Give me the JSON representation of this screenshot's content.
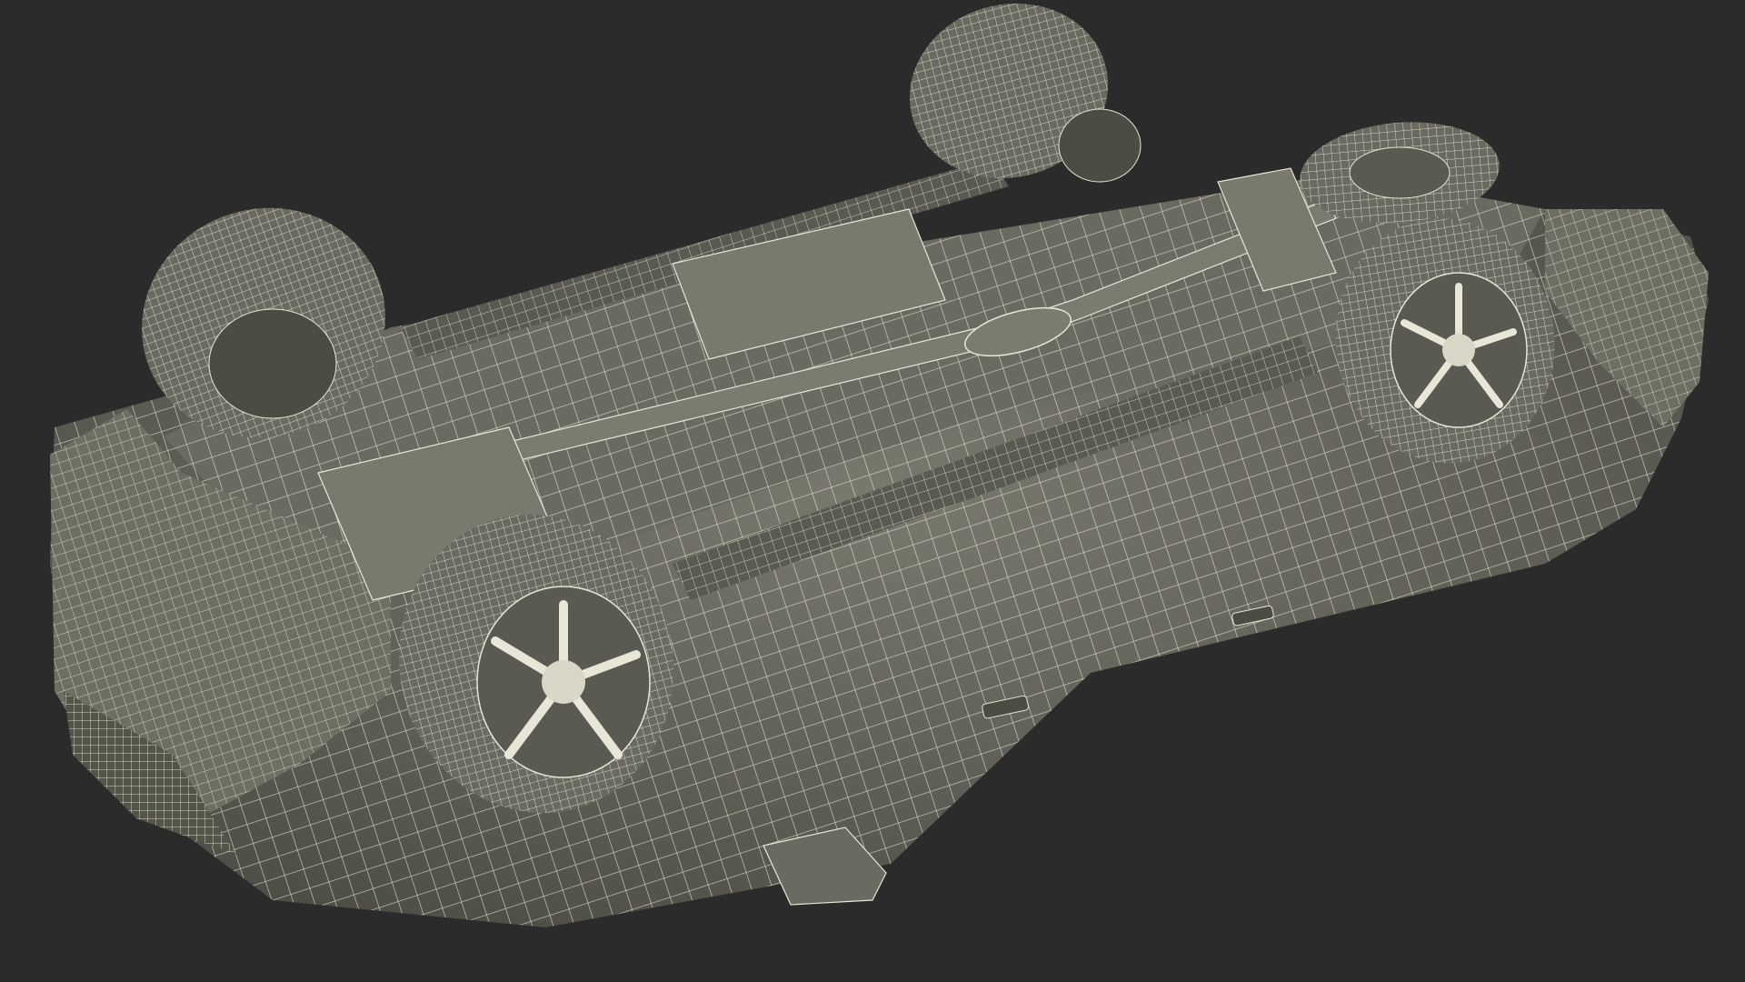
{
  "scene": {
    "background_color": "#2b2b2b",
    "model_fill_color": "#6b6a60",
    "model_dark_color": "#4a4943",
    "wire_color": "#e8e6d6"
  }
}
